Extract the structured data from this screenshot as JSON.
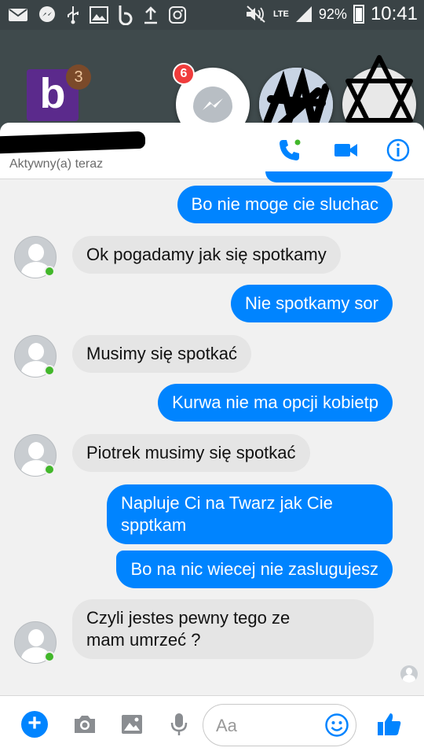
{
  "status_bar": {
    "network": "LTE",
    "battery": "92%",
    "time": "10:41"
  },
  "chat_heads": {
    "app_badge_count": "3",
    "messenger_badge_count": "6"
  },
  "conversation": {
    "status": "Aktywny(a) teraz",
    "messages": [
      {
        "from": "me",
        "text": "Bo nie moge cie sluchac"
      },
      {
        "from": "them",
        "text": "Ok pogadamy jak się spotkamy"
      },
      {
        "from": "me",
        "text": "Nie spotkamy sor"
      },
      {
        "from": "them",
        "text": "Musimy się spotkać"
      },
      {
        "from": "me",
        "text": "Kurwa nie ma opcji kobietp"
      },
      {
        "from": "them",
        "text": "Piotrek musimy się spotkać"
      },
      {
        "from": "me",
        "text_line1": "Napluje Ci na Twarz jak Cie",
        "text_line2": "spptkam"
      },
      {
        "from": "me",
        "text": "Bo na nic wiecej nie zaslugujesz"
      },
      {
        "from": "them",
        "text_line1": "Czyli jestes pewny tego ze",
        "text_line2": "mam umrzeć ?"
      }
    ]
  },
  "composer": {
    "placeholder": "Aa"
  },
  "colors": {
    "outgoing_bubble": "#0084ff",
    "incoming_bubble": "#e5e5e5",
    "online_dot": "#42b72a",
    "badge": "#f03c3c"
  }
}
